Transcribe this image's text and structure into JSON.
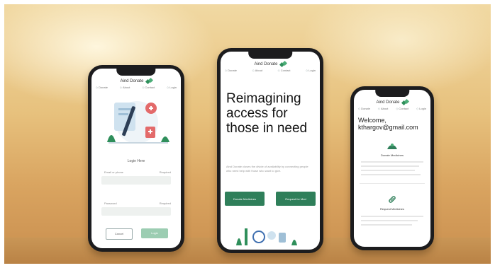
{
  "brand": {
    "name": "Aind Donate"
  },
  "nav": [
    "Donate",
    "About",
    "Contact",
    "Login"
  ],
  "phone_login": {
    "title": "Login Here",
    "email_label": "Email or phone",
    "email_hint": "Required",
    "password_label": "Password",
    "password_hint": "Required",
    "secondary_button": "Cancel",
    "primary_button": "Login"
  },
  "phone_hero": {
    "headline": "Reimagining access for those in need",
    "subtext": "Aind Donate closes the divide of availability by connecting people who need help with those who want to give.",
    "button_left": "Donate Medicines",
    "button_right": "Request for Med"
  },
  "phone_welcome": {
    "greeting": "Welcome,",
    "email": "kthargov@gmail.com",
    "section1_title": "Donate Medicines",
    "section2_title": "Request Medicines"
  },
  "colors": {
    "accent": "#2f7f5a",
    "accent_light": "#9ccdb2"
  }
}
